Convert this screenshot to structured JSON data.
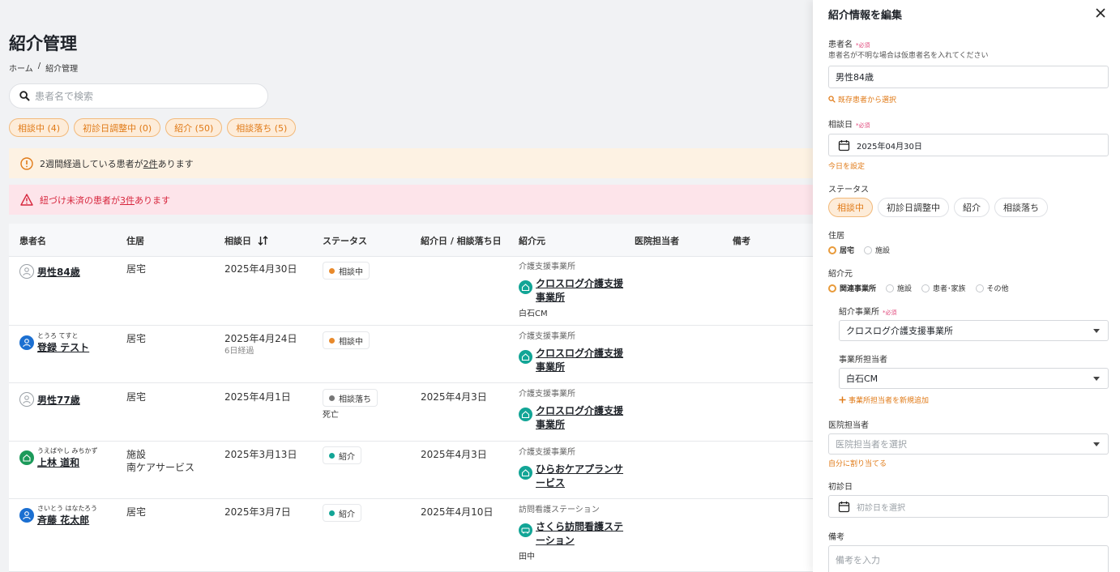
{
  "page": {
    "title": "紹介管理",
    "breadcrumb": [
      "ホーム",
      "/",
      "紹介管理"
    ],
    "search_placeholder": "患者名で検索"
  },
  "filters": [
    "相談中 (4)",
    "初診日調整中 (0)",
    "紹介 (50)",
    "相談落ち (5)"
  ],
  "alerts": {
    "warn": {
      "pre": "2週間経過している患者が",
      "link": "2件",
      "post": "あります"
    },
    "err": {
      "pre": "紐づけ未済の患者が",
      "link": "3件",
      "post": "あります"
    }
  },
  "table": {
    "headers": [
      "患者名",
      "住居",
      "相談日",
      "ステータス",
      "紹介日 / 相談落ち日",
      "紹介元",
      "医院担当者",
      "備考"
    ],
    "rows": [
      {
        "kana": "",
        "name": "男性84歳",
        "avatar": "grey",
        "residence": "居宅",
        "residence2": "",
        "date": "2025年4月30日",
        "elapsed": "",
        "status": "相談中",
        "status_color": "#e8892b",
        "status_note": "",
        "referral_date": "",
        "ref_type": "介護支援事業所",
        "ref_name": "クロスログ介護支援事業所",
        "ref_cm": "白石CM"
      },
      {
        "kana": "とうろ てすと",
        "name": "登録 テスト",
        "avatar": "blue",
        "residence": "居宅",
        "residence2": "",
        "date": "2025年4月24日",
        "elapsed": "6日経過",
        "status": "相談中",
        "status_color": "#e8892b",
        "status_note": "",
        "referral_date": "",
        "ref_type": "介護支援事業所",
        "ref_name": "クロスログ介護支援事業所",
        "ref_cm": ""
      },
      {
        "kana": "",
        "name": "男性77歳",
        "avatar": "grey",
        "residence": "居宅",
        "residence2": "",
        "date": "2025年4月1日",
        "elapsed": "",
        "status": "相談落ち",
        "status_color": "#777777",
        "status_note": "死亡",
        "referral_date": "2025年4月3日",
        "ref_type": "介護支援事業所",
        "ref_name": "クロスログ介護支援事業所",
        "ref_cm": ""
      },
      {
        "kana": "うえばやし みちかず",
        "name": "上林 道和",
        "avatar": "green",
        "residence": "施設",
        "residence2": "南ケアサービス",
        "date": "2025年3月13日",
        "elapsed": "",
        "status": "紹介",
        "status_color": "#12a596",
        "status_note": "",
        "referral_date": "2025年4月3日",
        "ref_type": "介護支援事業所",
        "ref_name": "ひらおケアプランサービス",
        "ref_cm": ""
      },
      {
        "kana": "さいとう はなたろう",
        "name": "斉藤 花太郎",
        "avatar": "blue",
        "residence": "居宅",
        "residence2": "",
        "date": "2025年3月7日",
        "elapsed": "",
        "status": "紹介",
        "status_color": "#12a596",
        "status_note": "",
        "referral_date": "2025年4月10日",
        "ref_type": "訪問看護ステーション",
        "ref_name": "さくら訪問看護ステーション",
        "ref_cm": "田中"
      }
    ]
  },
  "panel": {
    "title": "紹介情報を編集",
    "patient_label": "患者名",
    "required": "*必須",
    "patient_hint": "患者名が不明な場合は仮患者名を入れてください",
    "patient_value": "男性84歳",
    "select_existing": "既存患者から選択",
    "consult_label": "相談日",
    "consult_value": "2025年04月30日",
    "today": "今日を設定",
    "status_label": "ステータス",
    "status_options": [
      "相談中",
      "初診日調整中",
      "紹介",
      "相談落ち"
    ],
    "residence_label": "住居",
    "residence_options": [
      "居宅",
      "施設"
    ],
    "source_label": "紹介元",
    "source_options": [
      "関連事業所",
      "施設",
      "患者･家族",
      "その他"
    ],
    "office_label": "紹介事業所",
    "office_value": "クロスログ介護支援事業所",
    "staff_label": "事業所担当者",
    "staff_value": "白石CM",
    "add_staff": "事業所担当者を新規追加",
    "clinic_label": "医院担当者",
    "clinic_placeholder": "医院担当者を選択",
    "assign_self": "自分に割り当てる",
    "first_visit_label": "初診日",
    "first_visit_placeholder": "初診日を選択",
    "note_label": "備考",
    "note_placeholder": "備考を入力"
  },
  "colors": {
    "accent": "#e07a17",
    "error": "#d7263d",
    "teal": "#12a596"
  }
}
